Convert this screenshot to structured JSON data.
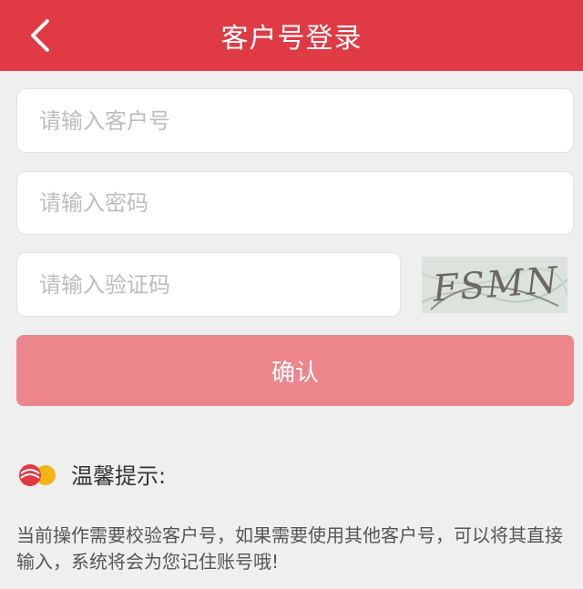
{
  "header": {
    "title": "客户号登录"
  },
  "form": {
    "customer_placeholder": "请输入客户号",
    "password_placeholder": "请输入密码",
    "captcha_placeholder": "请输入验证码",
    "captcha_text": "FSMN",
    "confirm_label": "确认"
  },
  "tip": {
    "title": "温馨提示:",
    "text": "当前操作需要校验客户号，如果需要使用其他客户号，可以将其直接输入，系统将会为您记住账号哦!"
  },
  "colors": {
    "header_bg": "#e03a44",
    "button_bg": "#ec868c",
    "page_bg": "#efefef"
  }
}
